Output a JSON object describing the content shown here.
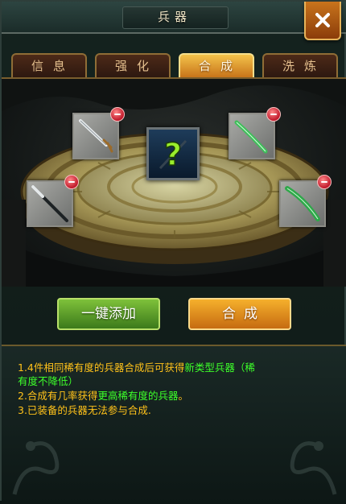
{
  "window": {
    "title": "兵器"
  },
  "tabs": [
    {
      "label": "信息",
      "active": false
    },
    {
      "label": "强化",
      "active": false
    },
    {
      "label": "合成",
      "active": true
    },
    {
      "label": "洗炼",
      "active": false
    }
  ],
  "slots": [
    {
      "name": "weapon-slot-top-left",
      "weapon": "silver-sword"
    },
    {
      "name": "weapon-slot-top-right",
      "weapon": "jade-sword"
    },
    {
      "name": "weapon-slot-bottom-left",
      "weapon": "silver-spear"
    },
    {
      "name": "weapon-slot-bottom-right",
      "weapon": "jade-blade"
    }
  ],
  "result_slot": {
    "symbol": "?"
  },
  "buttons": {
    "add_all": "一键添加",
    "combine": "合成"
  },
  "info": {
    "line1_prefix": "1.4件相同稀有度的兵器合成后可获得",
    "line1_highlight": "新类型兵器（稀",
    "line1b_highlight": "有度不降低）",
    "line2_prefix": "2.合成有几率获得",
    "line2_highlight": "更高稀有度的兵器",
    "line2_suffix": "。",
    "line3": "3.已装备的兵器无法参与合成."
  },
  "colors": {
    "info_text": "#ffc21a",
    "info_highlight": "#3dff2a",
    "active_tab": "#f3c24a",
    "add_button": "#6aa82e",
    "combine_button": "#eb9b22"
  }
}
